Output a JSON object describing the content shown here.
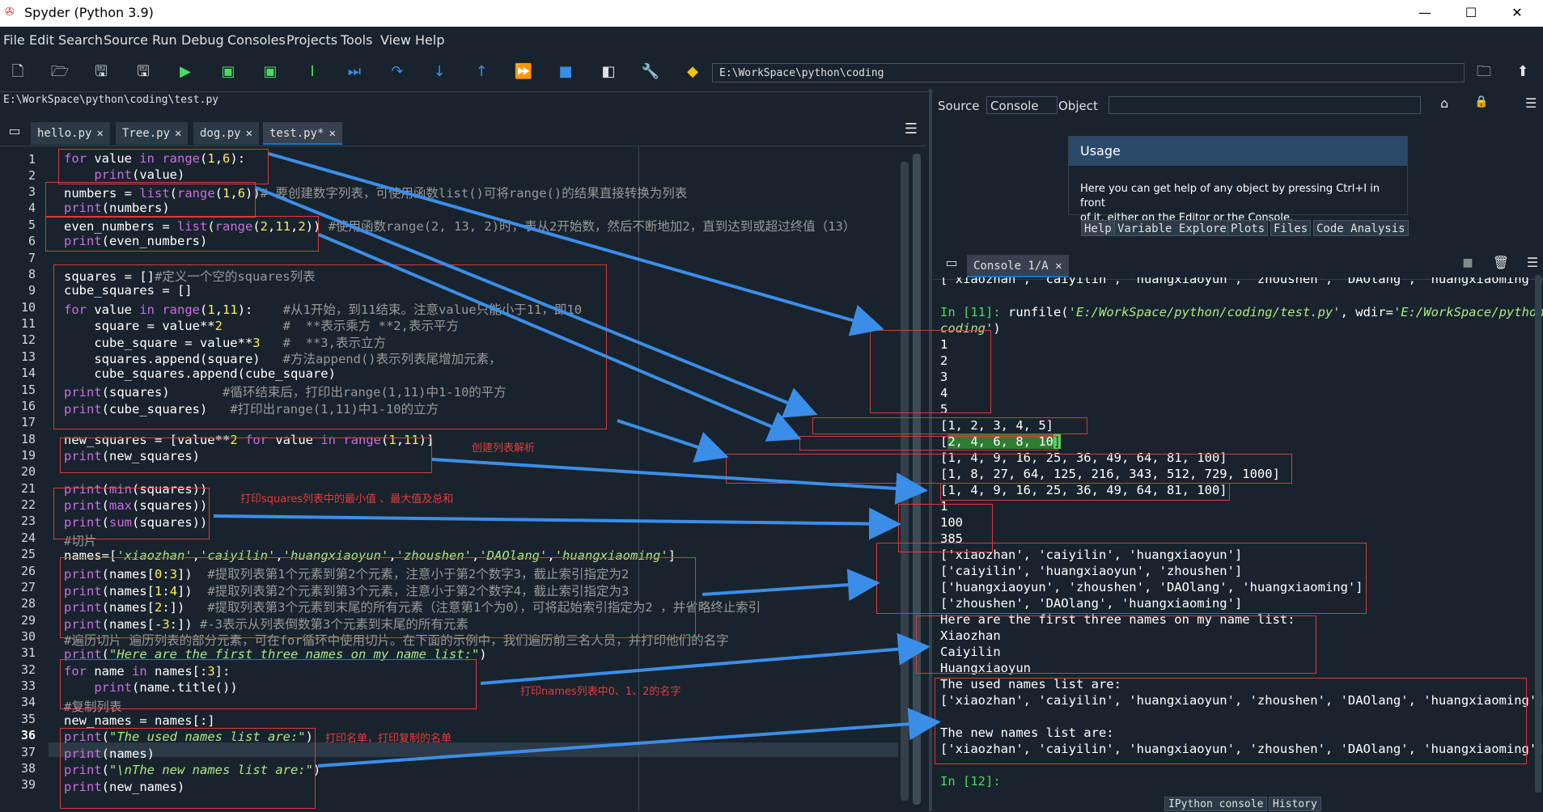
{
  "window": {
    "title": "Spyder (Python 3.9)",
    "minimize": "—",
    "maximize": "☐",
    "close": "✕"
  },
  "menu": [
    "File",
    "Edit",
    "Search",
    "Source",
    "Run",
    "Debug",
    "Consoles",
    "Projects",
    "Tools",
    "View",
    "Help"
  ],
  "toolbar": {
    "working_dir": "E:\\WorkSpace\\python\\coding"
  },
  "editor": {
    "file_path": "E:\\WorkSpace\\python\\coding\\test.py",
    "tabs": [
      {
        "label": "hello.py",
        "close": "✕"
      },
      {
        "label": "Tree.py",
        "close": "✕"
      },
      {
        "label": "dog.py",
        "close": "✕"
      },
      {
        "label": "test.py*",
        "close": "✕"
      }
    ],
    "current_line": 36,
    "line_numbers": [
      "1",
      "2",
      "3",
      "4",
      "5",
      "6",
      "7",
      "8",
      "9",
      "10",
      "11",
      "12",
      "13",
      "14",
      "15",
      "16",
      "17",
      "18",
      "19",
      "20",
      "21",
      "22",
      "23",
      "24",
      "25",
      "26",
      "27",
      "28",
      "29",
      "30",
      "31",
      "32",
      "33",
      "34",
      "35",
      "36",
      "37",
      "38",
      "39"
    ],
    "comments": {
      "l3": "# 要创建数字列表，可使用函数list()可将range()的结果直接转换为列表",
      "l5": "#使用函数range(2, 13, 2)时，表从2开始数，然后不断地加2，直到达到或超过终值（13）",
      "l8": "#定义一个空的squares列表",
      "l10": "#从1开始，到11结束。注意value只能小于11，即10",
      "l11": "#  **表示乘方 **2,表示平方",
      "l12": "#  **3,表示立方",
      "l13": "#方法append()表示列表尾增加元素，",
      "l15": "#循环结束后，打印出range(1,11)中1-10的平方",
      "l16": "#打印出range(1,11)中1-10的立方",
      "l24": "#切片",
      "l26": "#提取列表第1个元素到第2个元素，注意小于第2个数字3，截止索引指定为2",
      "l27": "#提取列表第2个元素到第3个元素，注意小于第2个数字4，截止索引指定为3",
      "l28": "#提取列表第3个元素到末尾的所有元素（注意第1个为0），可将起始索引指定为2 ，并省略终止索引",
      "l29": "#-3表示从列表倒数第3个元素到末尾的所有元素",
      "l30": "#遍历切片 遍历列表的部分元素，可在for循环中使用切片。在下面的示例中，我们遍历前三名人员，并打印他们的名字",
      "l34": "#复制列表"
    },
    "annotations": {
      "list_comp": "创建列表解析",
      "minmax": "打印squares列表中的最小值 、最大值及总和",
      "first3": "打印names列表中0、1、2的名字",
      "copy": "打印名单，打印复制的名单"
    }
  },
  "help_pane": {
    "source_label": "Source",
    "source_value": "Console",
    "object_label": "Object",
    "usage_title": "Usage",
    "usage_text_1": "Here you can get help of any object by pressing Ctrl+I in front",
    "usage_text_2": "of it, either on the Editor or the Console.",
    "tabs": [
      "Help",
      "Variable Explorer",
      "Plots",
      "Files",
      "Code Analysis"
    ]
  },
  "console": {
    "tab_label": "Console 1/A",
    "tab_close": "✕",
    "lines": {
      "top_cut": "['xiaozhan', 'caiyilin', 'huangxiaoyun', 'zhoushen', 'DAOlang', 'huangxiaoming']",
      "prompt11": "In [11]:",
      "runfile": " runfile(",
      "runfile_arg1": "'E:/WorkSpace/python/coding/test.py'",
      "runfile_mid": ", wdir=",
      "runfile_arg2": "'E:/WorkSpace/python/",
      "runfile_arg2b": "coding'",
      "runfile_end": ")",
      "o1": "1",
      "o2": "2",
      "o3": "3",
      "o4": "4",
      "o5": "5",
      "numbers": "[1, 2, 3, 4, 5]",
      "even_pre": "[",
      "even": "2, 4, 6, 8, 10",
      "even_post": "]",
      "squares": "[1, 4, 9, 16, 25, 36, 49, 64, 81, 100]",
      "cubes": "[1, 8, 27, 64, 125, 216, 343, 512, 729, 1000]",
      "new_squares": "[1, 4, 9, 16, 25, 36, 49, 64, 81, 100]",
      "min": "1",
      "max": "100",
      "sum": "385",
      "s1": "['xiaozhan', 'caiyilin', 'huangxiaoyun']",
      "s2": "['caiyilin', 'huangxiaoyun', 'zhoushen']",
      "s3": "['huangxiaoyun', 'zhoushen', 'DAOlang', 'huangxiaoming']",
      "s4": "['zhoushen', 'DAOlang', 'huangxiaoming']",
      "first3_hdr": "Here are the first three names on my name list:",
      "n1": "Xiaozhan",
      "n2": "Caiyilin",
      "n3": "Huangxiaoyun",
      "used_hdr": "The used names list are:",
      "used_list": "['xiaozhan', 'caiyilin', 'huangxiaoyun', 'zhoushen', 'DAOlang', 'huangxiaoming']",
      "new_hdr": "The new names list are:",
      "new_list": "['xiaozhan', 'caiyilin', 'huangxiaoyun', 'zhoushen', 'DAOlang', 'huangxiaoming']",
      "prompt12": "In [12]:"
    },
    "bottom_tabs": [
      "IPython console",
      "History"
    ]
  },
  "colors": {
    "bg": "#19232d",
    "keyword": "#c670e0",
    "number": "#faed5c",
    "string": "#b0e686",
    "comment": "#999999",
    "annotation": "#e63b3b",
    "arrow": "#3b8ee8",
    "prompt": "#4cd964"
  }
}
